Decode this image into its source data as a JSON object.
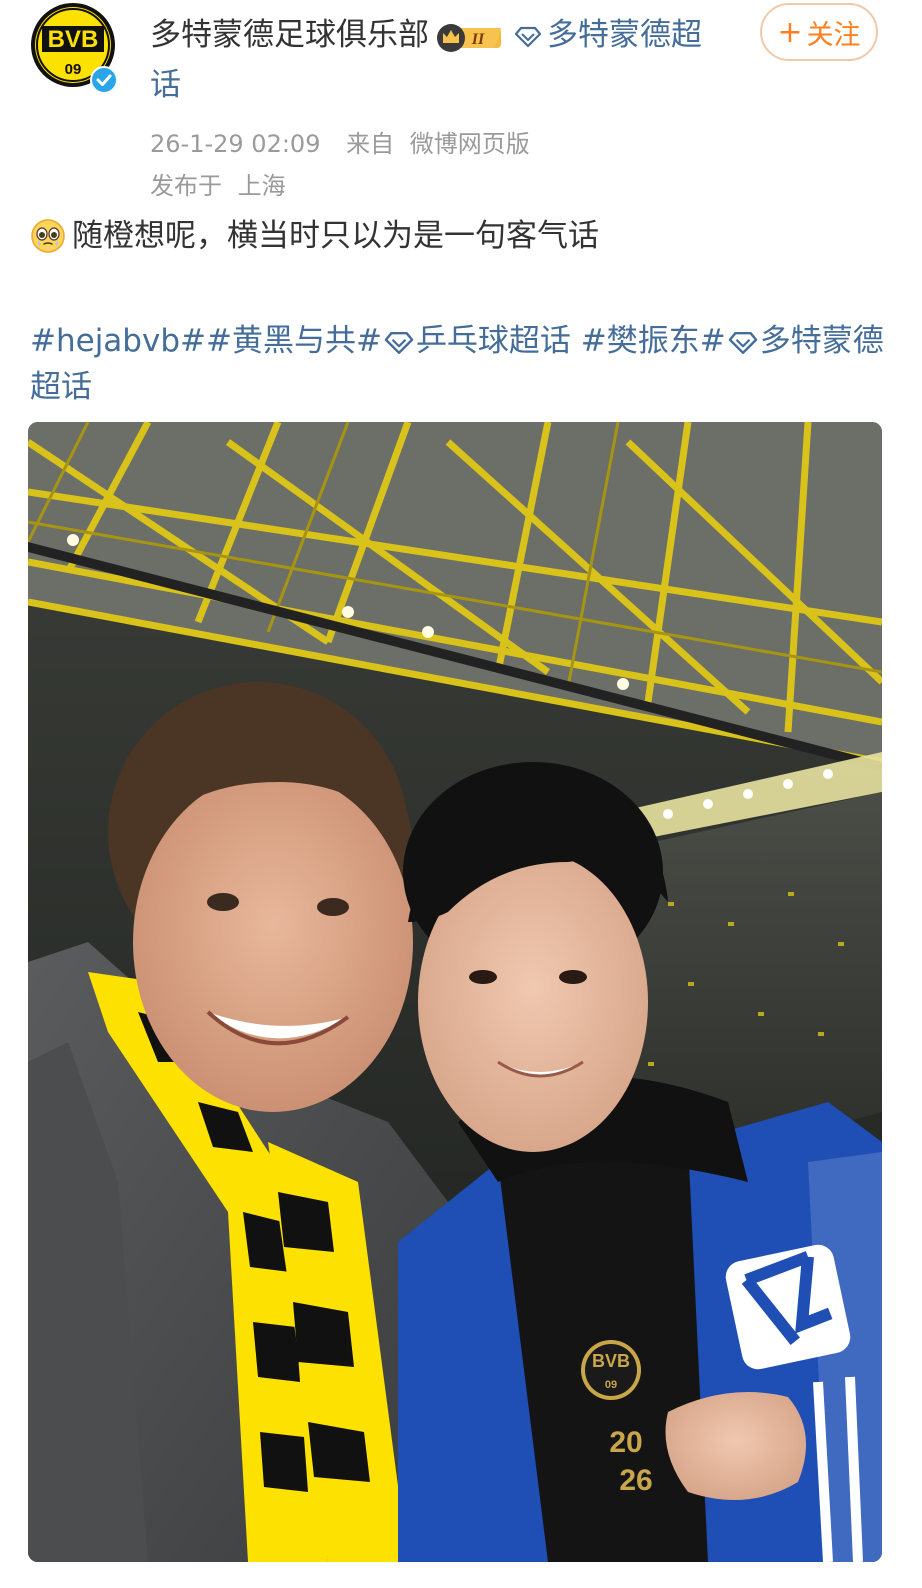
{
  "author": {
    "name": "多特蒙德足球俱乐部",
    "badge_level": "II",
    "supertopic_label": "多特蒙德超话",
    "avatar_letters": "BVB",
    "avatar_number": "09"
  },
  "follow_button": {
    "label": "关注",
    "plus": "+"
  },
  "meta": {
    "timestamp": "26-1-29 02:09",
    "source_prefix": "来自",
    "source": "微博网页版",
    "location_prefix": "发布于",
    "location": "上海"
  },
  "post": {
    "text": "随橙想呢，横当时只以为是一句客气话"
  },
  "tags": {
    "t1": "#hejabvb#",
    "t2": "#黄黑与共#",
    "t3": "乒乓球超话",
    "t4": "#樊振东#",
    "t5": "多特蒙德超话"
  },
  "photo": {
    "crest_text": "BVB",
    "crest_number": "09",
    "shirt_year_top": "20",
    "shirt_year_bottom": "26"
  },
  "colors": {
    "link": "#456d9a",
    "follow_orange": "#ff7f1f",
    "bvb_yellow": "#fde100",
    "verified_blue": "#2aa5e8"
  },
  "icons": [
    "bvb-avatar-icon",
    "verified-icon",
    "crown-badge-icon",
    "supertopic-diamond-icon",
    "teary-emoji-icon"
  ]
}
